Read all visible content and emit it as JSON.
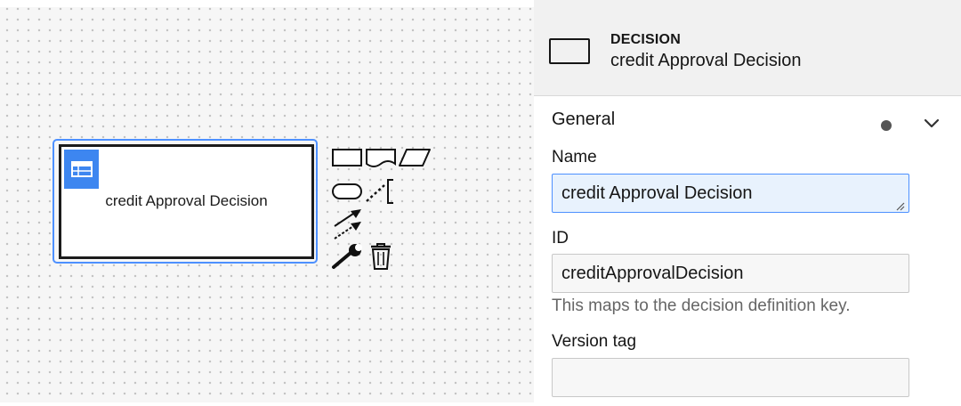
{
  "canvas": {
    "decision": {
      "label": "credit Approval Decision",
      "icon": "decision-table-icon"
    },
    "context_pad": {
      "entries": [
        {
          "name": "append-decision-icon"
        },
        {
          "name": "append-knowledge-source-icon"
        },
        {
          "name": "append-input-data-icon"
        },
        {
          "name": "append-business-knowledge-model-icon"
        },
        {
          "name": "append-text-annotation-icon"
        },
        {
          "name": "connect-icon"
        },
        {
          "name": "change-type-wrench-icon"
        },
        {
          "name": "delete-trash-icon"
        }
      ]
    }
  },
  "panel": {
    "header": {
      "type": "DECISION",
      "name": "credit Approval Decision"
    },
    "group": {
      "title": "General",
      "has_data_indicator": true,
      "expanded": true
    },
    "fields": {
      "name": {
        "label": "Name",
        "value": "credit Approval Decision"
      },
      "id": {
        "label": "ID",
        "value": "creditApprovalDecision",
        "description": "This maps to the decision definition key."
      },
      "version_tag": {
        "label": "Version tag",
        "value": ""
      }
    }
  },
  "colors": {
    "selection": "#4d90ff",
    "decision_icon_bg": "#3d86f0",
    "focused_input_bg": "#e8f2fd",
    "panel_header_bg": "#f1f1f1"
  }
}
